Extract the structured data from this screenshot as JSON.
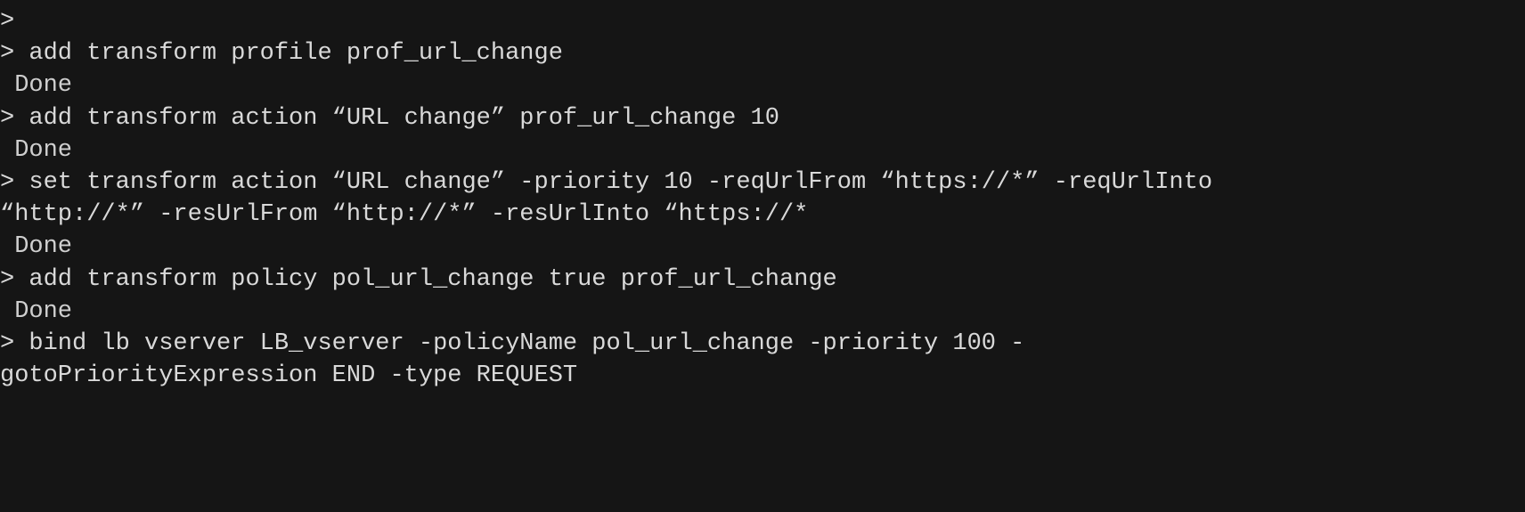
{
  "terminal": {
    "lines": [
      {
        "kind": "prompt",
        "text": ">"
      },
      {
        "kind": "prompt",
        "text": "> add transform profile prof_url_change"
      },
      {
        "kind": "output",
        "text": " Done"
      },
      {
        "kind": "prompt",
        "text": "> add transform action “URL change” prof_url_change 10"
      },
      {
        "kind": "output",
        "text": " Done"
      },
      {
        "kind": "prompt",
        "text": "> set transform action “URL change” -priority 10 -reqUrlFrom “https://*” -reqUrlInto"
      },
      {
        "kind": "continuation",
        "text": "“http://*” -resUrlFrom “http://*” -resUrlInto “https://*"
      },
      {
        "kind": "output",
        "text": " Done"
      },
      {
        "kind": "prompt",
        "text": "> add transform policy pol_url_change true prof_url_change"
      },
      {
        "kind": "output",
        "text": " Done"
      },
      {
        "kind": "prompt",
        "text": "> bind lb vserver LB_vserver -policyName pol_url_change -priority 100 -"
      },
      {
        "kind": "continuation",
        "text": "gotoPriorityExpression END -type REQUEST"
      }
    ]
  },
  "colors": {
    "background": "#151515",
    "text": "#d9d9d9"
  }
}
